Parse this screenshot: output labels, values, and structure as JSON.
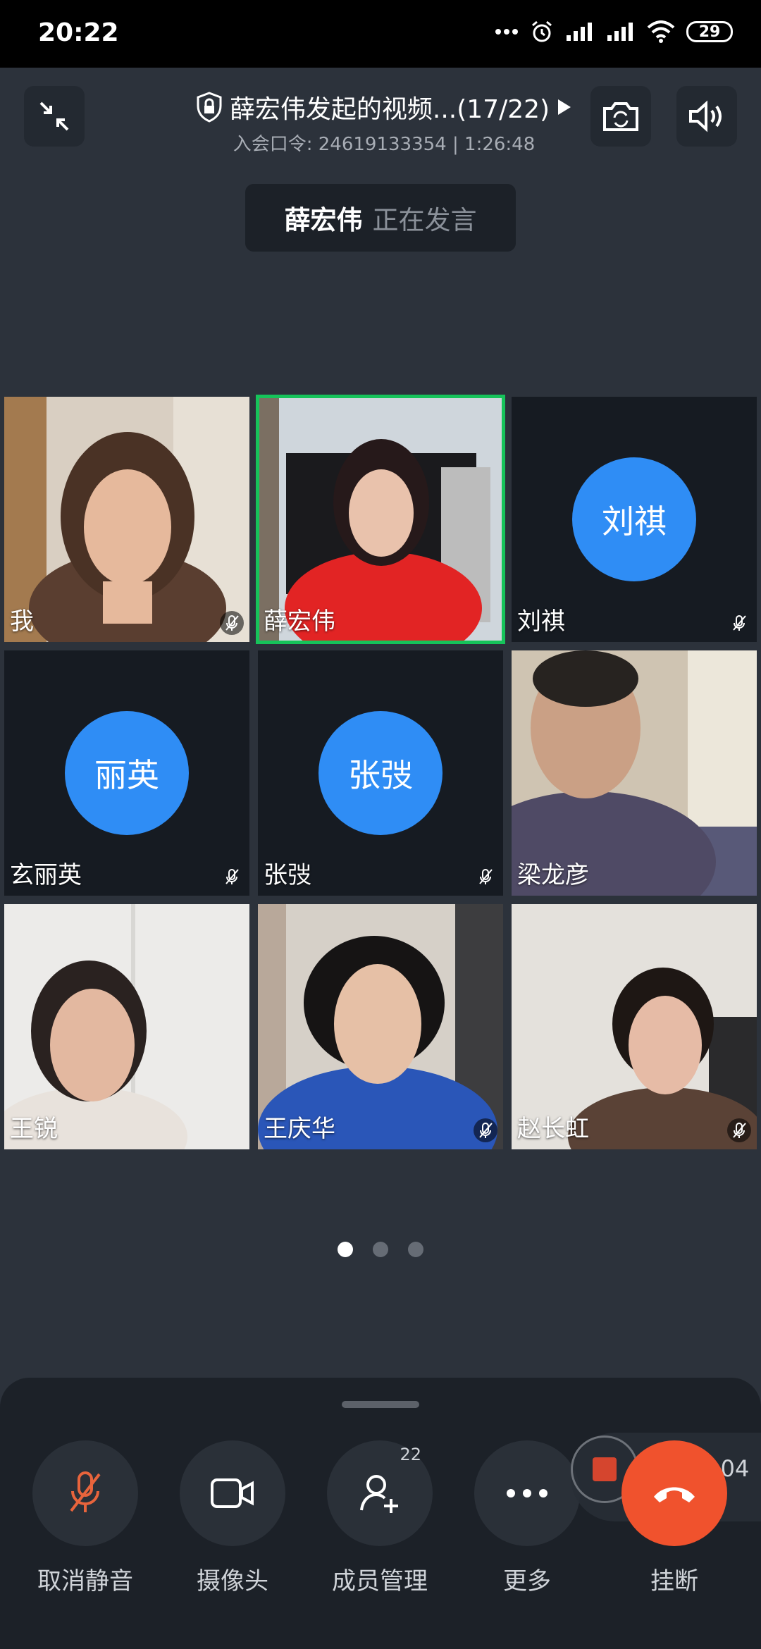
{
  "status_bar": {
    "time": "20:22",
    "battery": "29"
  },
  "header": {
    "title": "薛宏伟发起的视频...(17/22)",
    "meeting_code_label": "入会口令: 24619133354",
    "separator": "|",
    "duration": "1:26:48"
  },
  "speaking": {
    "name": "薛宏伟",
    "status": "正在发言"
  },
  "participants": [
    {
      "name": "我",
      "muted": true,
      "video": true
    },
    {
      "name": "薛宏伟",
      "muted": false,
      "video": true,
      "active": true
    },
    {
      "name": "刘祺",
      "avatar_text": "刘祺",
      "muted": true,
      "video": false
    },
    {
      "name": "玄丽英",
      "avatar_text": "丽英",
      "muted": true,
      "video": false
    },
    {
      "name": "张弢",
      "avatar_text": "张弢",
      "muted": true,
      "video": false
    },
    {
      "name": "梁龙彦",
      "muted": false,
      "video": true
    },
    {
      "name": "王锐",
      "muted": false,
      "video": true
    },
    {
      "name": "王庆华",
      "muted": true,
      "video": true
    },
    {
      "name": "赵长虹",
      "muted": true,
      "video": true
    }
  ],
  "pagination": {
    "pages": 3,
    "current": 1
  },
  "controls": {
    "unmute": "取消静音",
    "camera": "摄像头",
    "members": "成员管理",
    "members_badge": "22",
    "more": "更多",
    "hangup": "挂断"
  },
  "recording": {
    "time": "1:20:04"
  },
  "colors": {
    "accent_blue": "#2f8df5",
    "active_border": "#16c35a",
    "hangup": "#f0522d",
    "mute_icon": "#e8643c"
  }
}
